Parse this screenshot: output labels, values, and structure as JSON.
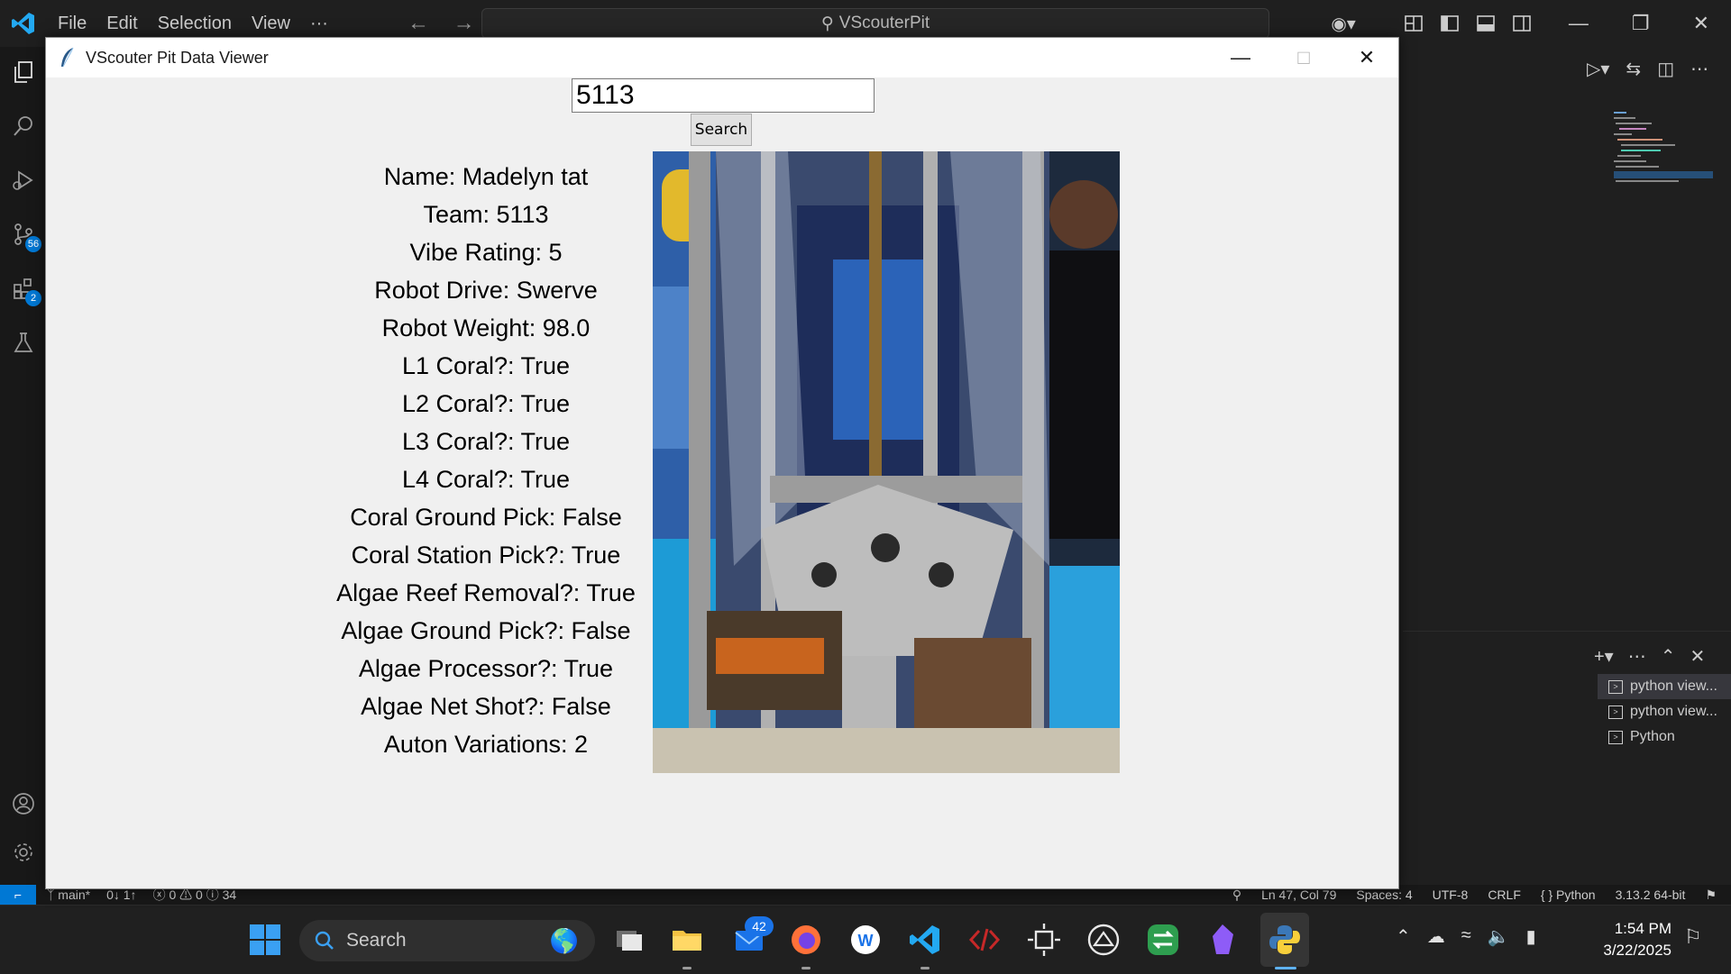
{
  "vscode": {
    "menu": [
      "File",
      "Edit",
      "Selection",
      "View",
      "···"
    ],
    "command_center": "VScouterPit",
    "source_control_badge": "56",
    "extensions_badge": "2",
    "accent_color": "#0078d4"
  },
  "terminal_tabs": [
    "python view...",
    "python view...",
    "Python"
  ],
  "statusbar": {
    "branch": "main*",
    "sync": "0↓ 1↑",
    "problems": "ⓧ 0 ⚠ 0 ⓘ 34",
    "position": "Ln 47, Col 79",
    "spaces": "Spaces: 4",
    "encoding": "UTF-8",
    "eol": "CRLF",
    "language": "{ } Python",
    "interpreter": "3.13.2 64-bit"
  },
  "taskbar": {
    "search_label": "Search",
    "mail_badge": "42",
    "time": "1:54 PM",
    "date": "3/22/2025"
  },
  "app_window": {
    "title": "VScouter Pit Data Viewer",
    "search_value": "5113",
    "search_button": "Search",
    "fields": [
      "Name: Madelyn tat",
      "Team: 5113",
      "Vibe Rating: 5",
      "Robot Drive: Swerve",
      "Robot Weight: 98.0",
      "L1 Coral?: True",
      "L2 Coral?: True",
      "L3 Coral?: True",
      "L4 Coral?: True",
      "Coral Ground Pick: False",
      "Coral Station Pick?: True",
      "Algae Reef Removal?: True",
      "Algae Ground Pick?: False",
      "Algae Processor?: True",
      "Algae Net Shot?: False",
      "Auton Variations: 2"
    ]
  }
}
